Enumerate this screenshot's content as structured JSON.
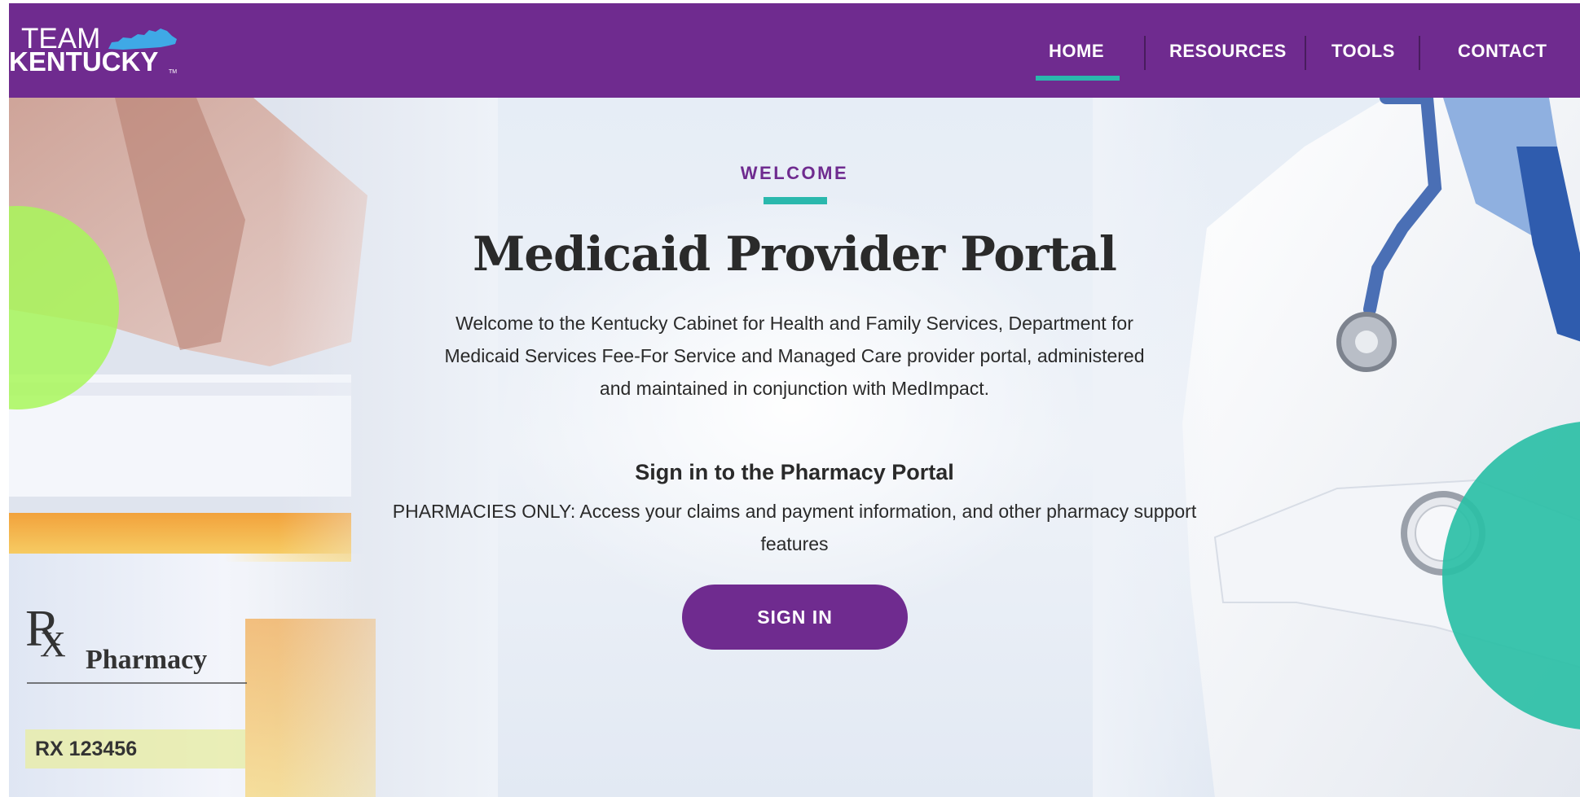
{
  "header": {
    "logo": {
      "line1": "TEAM",
      "line2": "KENTUCKY",
      "trademark": "TM"
    },
    "nav": [
      {
        "label": "HOME",
        "active": true
      },
      {
        "label": "RESOURCES",
        "active": false
      },
      {
        "label": "TOOLS",
        "active": false
      },
      {
        "label": "CONTACT",
        "active": false
      }
    ]
  },
  "hero": {
    "eyebrow": "WELCOME",
    "title": "Medicaid Provider Portal",
    "intro": "Welcome to the Kentucky Cabinet for Health and Family Services, Department for Medicaid Services Fee-For Service and Managed Care provider portal, administered and maintained in conjunction with MedImpact.",
    "sign_in_heading": "Sign in to the Pharmacy Portal",
    "sign_in_description": "PHARMACIES ONLY: Access your claims and payment information, and other pharmacy support features",
    "sign_in_button": "SIGN IN",
    "photo_label": {
      "rx": "R",
      "rx_sub": "X",
      "pharmacy": "Pharmacy",
      "rx_number": "RX 123456"
    }
  },
  "colors": {
    "brand_purple": "#6f2b8f",
    "accent_teal": "#2ab8ad",
    "accent_green": "#a8f75a",
    "kentucky_map_blue": "#3fa9e6"
  }
}
